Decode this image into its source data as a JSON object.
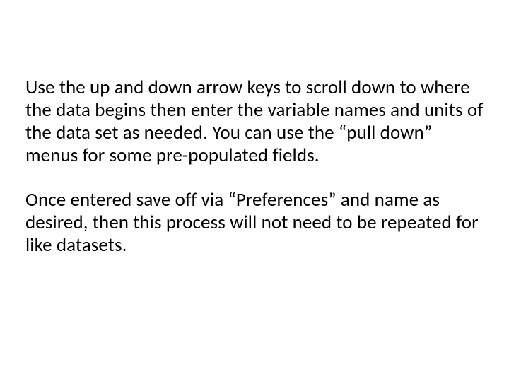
{
  "paragraphs": {
    "p1": "Use the up and down arrow keys to scroll down to where the data begins then enter the variable names and units of the data set as needed. You can use the “pull down” menus for some pre-populated fields.",
    "p2": "Once entered save off via “Preferences” and name as desired, then this process will not need to be repeated for like datasets."
  }
}
